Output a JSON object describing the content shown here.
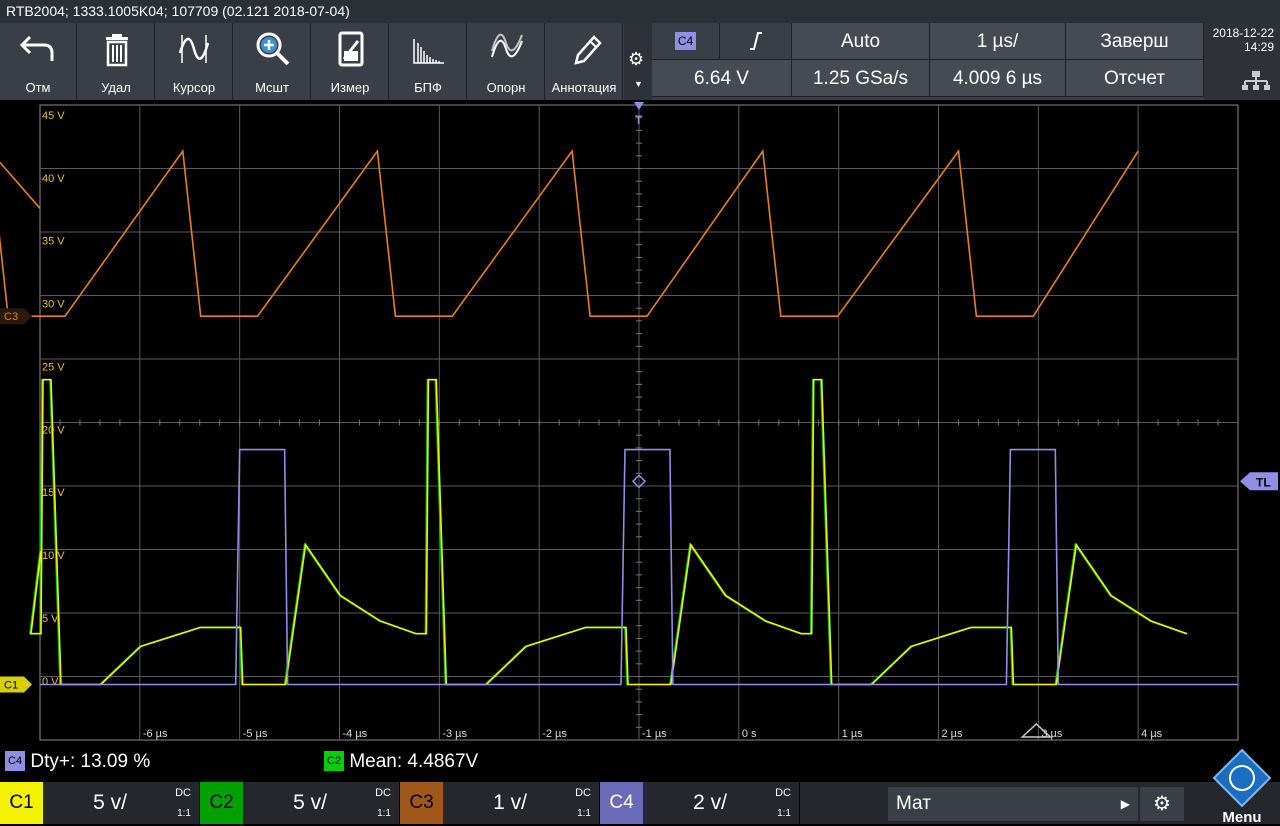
{
  "title": "RTB2004; 1333.1005K04; 107709 (02.121 2018-07-04)",
  "toolbar": {
    "tools": [
      {
        "label": "Отм",
        "icon": "undo-icon"
      },
      {
        "label": "Удал",
        "icon": "trash-icon"
      },
      {
        "label": "Курсор",
        "icon": "cursor-icon"
      },
      {
        "label": "Мсшт",
        "icon": "zoom-icon"
      },
      {
        "label": "Измер",
        "icon": "measure-icon"
      },
      {
        "label": "БПФ",
        "icon": "fft-icon"
      },
      {
        "label": "Опорн",
        "icon": "reference-icon"
      },
      {
        "label": "Аннотация",
        "icon": "pencil-icon"
      }
    ]
  },
  "trigger": {
    "source": "C4",
    "level": "6.64 V",
    "mode": "Auto",
    "sample_rate": "1.25 GSa/s",
    "timebase": "1 µs/",
    "position": "4.009 6 µs",
    "acq_state": "Заверш",
    "acq_mode": "Отсчет"
  },
  "datetime": {
    "date": "2018-12-22",
    "time": "14:29"
  },
  "plot": {
    "y_labels": [
      "45 V",
      "40 V",
      "35 V",
      "30 V",
      "25 V",
      "20 V",
      "15 V",
      "10 V",
      "5 V",
      "0 V"
    ],
    "x_labels": [
      "-6 µs",
      "-5 µs",
      "-4 µs",
      "-3 µs",
      "-2 µs",
      "-1 µs",
      "0 s",
      "1 µs",
      "2 µs",
      "3 µs",
      "4 µs"
    ],
    "c3_marker": "C3",
    "c12_marker": "C1",
    "trigger_level_marker": "TL",
    "trigger_pos_marker": "T"
  },
  "colors": {
    "c1": "#f4f200",
    "c2": "#00c800",
    "c3": "#e8801a",
    "c4": "#8f8fe6"
  },
  "measurements": [
    {
      "channel": "C4",
      "text": "Dty+: 13.09 %"
    },
    {
      "channel": "C2",
      "text": "Mean: 4.4867V"
    }
  ],
  "channels": [
    {
      "name": "C1",
      "scale": "5 v/",
      "coupling": "DC",
      "ratio": "1:1"
    },
    {
      "name": "C2",
      "scale": "5 v/",
      "coupling": "DC",
      "ratio": "1:1"
    },
    {
      "name": "C3",
      "scale": "1 v/",
      "coupling": "DC",
      "ratio": "1:1"
    },
    {
      "name": "C4",
      "scale": "2 v/",
      "coupling": "DC",
      "ratio": "1:1"
    }
  ],
  "math": {
    "label": "Мат"
  },
  "menu_label": "Menu"
}
